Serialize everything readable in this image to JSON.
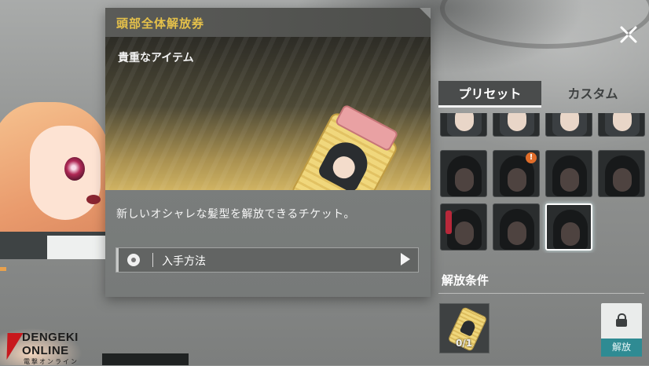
{
  "popup": {
    "title": "頭部全体解放券",
    "subtitle": "貴重なアイテム",
    "description": "新しいオシャレな髪型を解放できるチケット。",
    "acquire_label": "入手方法"
  },
  "tabs": [
    {
      "label": "プリセット",
      "active": true
    },
    {
      "label": "カスタム",
      "active": false
    }
  ],
  "hair_grid": {
    "rows": 4,
    "cols": 4,
    "selected_index": 10,
    "badge_text": "!"
  },
  "unlock_condition": {
    "title": "解放条件",
    "count_text": "0/1"
  },
  "unlock_button": {
    "label": "解放"
  },
  "watermark": {
    "line1": "DENGEKI",
    "line2": "ONLINE",
    "line3": "電撃オンライン"
  },
  "colors": {
    "title_gold": "#e4c04a",
    "unlock_teal": "#2f8b93",
    "badge_orange": "#e06d2a"
  },
  "icons": [
    "close-icon",
    "location-pin-icon",
    "arrow-right-icon",
    "lock-icon",
    "warning-badge-icon"
  ]
}
